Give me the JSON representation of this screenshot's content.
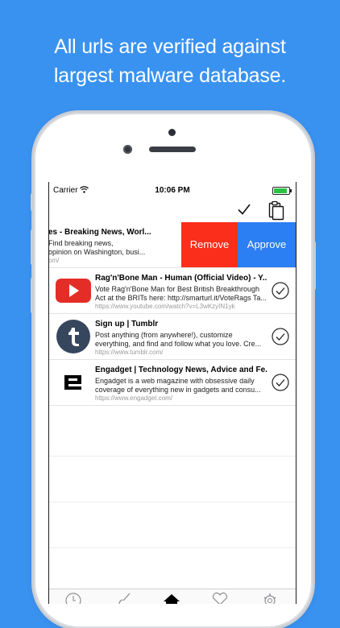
{
  "headline": {
    "line1": "All urls are verified against",
    "line2": "largest malware database."
  },
  "status_bar": {
    "carrier": "Carrier",
    "time": "10:06 PM"
  },
  "toolbar": {
    "check_all_icon": "checkmark-icon",
    "paste_icon": "clipboard-icon"
  },
  "swipe_actions": {
    "remove_label": "Remove",
    "remove_color": "#fb2d1b",
    "approve_label": "Approve",
    "approve_color": "#2c7ef3"
  },
  "links": [
    {
      "title": "es - Breaking News, Worl...",
      "desc_line1": "Find breaking news,",
      "desc_line2": "opinion on Washington, busi...",
      "url": "om/",
      "thumb": "none"
    },
    {
      "title": "Rag'n'Bone Man - Human (Official Video) - Y...",
      "desc_line1": "Vote Rag'n'Bone Man for Best British Breakthrough",
      "desc_line2": "Act at the BRITs here: http://smarturl.it/VoteRags Ta...",
      "url": "https://www.youtube.com/watch?v=L3wKzyIN1yk",
      "thumb": "youtube-logo"
    },
    {
      "title": "Sign up | Tumblr",
      "desc_line1": "Post anything (from anywhere!), customize",
      "desc_line2": "everything, and find and follow what you love.  Cre...",
      "url": "https://www.tumblr.com/",
      "thumb": "tumblr-logo"
    },
    {
      "title": "Engadget | Technology News, Advice and Fe...",
      "desc_line1": "Engadget is a web magazine with obsessive daily",
      "desc_line2": "coverage of everything new in gadgets and consu...",
      "url": "https://www.engadget.com/",
      "thumb": "engadget-logo"
    }
  ],
  "tabbar": {
    "tabs": [
      "history-icon",
      "brush-icon",
      "home-icon",
      "heart-icon",
      "gear-icon"
    ]
  },
  "colors": {
    "background": "#3a92f0",
    "youtube_red": "#e52d27",
    "tumblr_navy": "#36465d"
  }
}
